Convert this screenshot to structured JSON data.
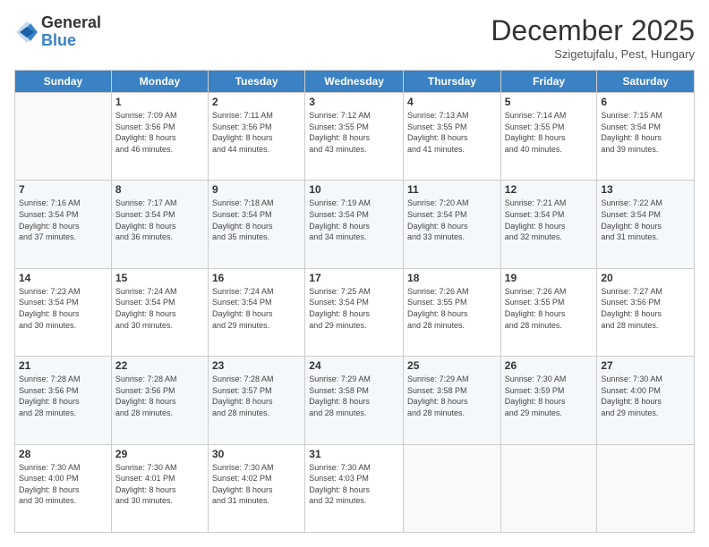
{
  "logo": {
    "general": "General",
    "blue": "Blue"
  },
  "header": {
    "month": "December 2025",
    "location": "Szigetujfalu, Pest, Hungary"
  },
  "days_of_week": [
    "Sunday",
    "Monday",
    "Tuesday",
    "Wednesday",
    "Thursday",
    "Friday",
    "Saturday"
  ],
  "weeks": [
    [
      {
        "day": "",
        "info": ""
      },
      {
        "day": "1",
        "info": "Sunrise: 7:09 AM\nSunset: 3:56 PM\nDaylight: 8 hours\nand 46 minutes."
      },
      {
        "day": "2",
        "info": "Sunrise: 7:11 AM\nSunset: 3:56 PM\nDaylight: 8 hours\nand 44 minutes."
      },
      {
        "day": "3",
        "info": "Sunrise: 7:12 AM\nSunset: 3:55 PM\nDaylight: 8 hours\nand 43 minutes."
      },
      {
        "day": "4",
        "info": "Sunrise: 7:13 AM\nSunset: 3:55 PM\nDaylight: 8 hours\nand 41 minutes."
      },
      {
        "day": "5",
        "info": "Sunrise: 7:14 AM\nSunset: 3:55 PM\nDaylight: 8 hours\nand 40 minutes."
      },
      {
        "day": "6",
        "info": "Sunrise: 7:15 AM\nSunset: 3:54 PM\nDaylight: 8 hours\nand 39 minutes."
      }
    ],
    [
      {
        "day": "7",
        "info": "Sunrise: 7:16 AM\nSunset: 3:54 PM\nDaylight: 8 hours\nand 37 minutes."
      },
      {
        "day": "8",
        "info": "Sunrise: 7:17 AM\nSunset: 3:54 PM\nDaylight: 8 hours\nand 36 minutes."
      },
      {
        "day": "9",
        "info": "Sunrise: 7:18 AM\nSunset: 3:54 PM\nDaylight: 8 hours\nand 35 minutes."
      },
      {
        "day": "10",
        "info": "Sunrise: 7:19 AM\nSunset: 3:54 PM\nDaylight: 8 hours\nand 34 minutes."
      },
      {
        "day": "11",
        "info": "Sunrise: 7:20 AM\nSunset: 3:54 PM\nDaylight: 8 hours\nand 33 minutes."
      },
      {
        "day": "12",
        "info": "Sunrise: 7:21 AM\nSunset: 3:54 PM\nDaylight: 8 hours\nand 32 minutes."
      },
      {
        "day": "13",
        "info": "Sunrise: 7:22 AM\nSunset: 3:54 PM\nDaylight: 8 hours\nand 31 minutes."
      }
    ],
    [
      {
        "day": "14",
        "info": "Sunrise: 7:23 AM\nSunset: 3:54 PM\nDaylight: 8 hours\nand 30 minutes."
      },
      {
        "day": "15",
        "info": "Sunrise: 7:24 AM\nSunset: 3:54 PM\nDaylight: 8 hours\nand 30 minutes."
      },
      {
        "day": "16",
        "info": "Sunrise: 7:24 AM\nSunset: 3:54 PM\nDaylight: 8 hours\nand 29 minutes."
      },
      {
        "day": "17",
        "info": "Sunrise: 7:25 AM\nSunset: 3:54 PM\nDaylight: 8 hours\nand 29 minutes."
      },
      {
        "day": "18",
        "info": "Sunrise: 7:26 AM\nSunset: 3:55 PM\nDaylight: 8 hours\nand 28 minutes."
      },
      {
        "day": "19",
        "info": "Sunrise: 7:26 AM\nSunset: 3:55 PM\nDaylight: 8 hours\nand 28 minutes."
      },
      {
        "day": "20",
        "info": "Sunrise: 7:27 AM\nSunset: 3:56 PM\nDaylight: 8 hours\nand 28 minutes."
      }
    ],
    [
      {
        "day": "21",
        "info": "Sunrise: 7:28 AM\nSunset: 3:56 PM\nDaylight: 8 hours\nand 28 minutes."
      },
      {
        "day": "22",
        "info": "Sunrise: 7:28 AM\nSunset: 3:56 PM\nDaylight: 8 hours\nand 28 minutes."
      },
      {
        "day": "23",
        "info": "Sunrise: 7:28 AM\nSunset: 3:57 PM\nDaylight: 8 hours\nand 28 minutes."
      },
      {
        "day": "24",
        "info": "Sunrise: 7:29 AM\nSunset: 3:58 PM\nDaylight: 8 hours\nand 28 minutes."
      },
      {
        "day": "25",
        "info": "Sunrise: 7:29 AM\nSunset: 3:58 PM\nDaylight: 8 hours\nand 28 minutes."
      },
      {
        "day": "26",
        "info": "Sunrise: 7:30 AM\nSunset: 3:59 PM\nDaylight: 8 hours\nand 29 minutes."
      },
      {
        "day": "27",
        "info": "Sunrise: 7:30 AM\nSunset: 4:00 PM\nDaylight: 8 hours\nand 29 minutes."
      }
    ],
    [
      {
        "day": "28",
        "info": "Sunrise: 7:30 AM\nSunset: 4:00 PM\nDaylight: 8 hours\nand 30 minutes."
      },
      {
        "day": "29",
        "info": "Sunrise: 7:30 AM\nSunset: 4:01 PM\nDaylight: 8 hours\nand 30 minutes."
      },
      {
        "day": "30",
        "info": "Sunrise: 7:30 AM\nSunset: 4:02 PM\nDaylight: 8 hours\nand 31 minutes."
      },
      {
        "day": "31",
        "info": "Sunrise: 7:30 AM\nSunset: 4:03 PM\nDaylight: 8 hours\nand 32 minutes."
      },
      {
        "day": "",
        "info": ""
      },
      {
        "day": "",
        "info": ""
      },
      {
        "day": "",
        "info": ""
      }
    ]
  ]
}
